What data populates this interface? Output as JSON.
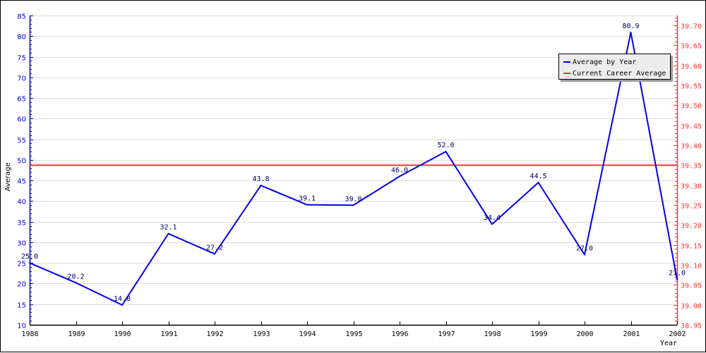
{
  "chart_data": {
    "type": "line",
    "title": "",
    "xlabel": "Year",
    "ylabel": "Average",
    "categories": [
      "1988",
      "1989",
      "1990",
      "1991",
      "1992",
      "1993",
      "1994",
      "1995",
      "1996",
      "1997",
      "1998",
      "1999",
      "2000",
      "2001",
      "2002"
    ],
    "series": [
      {
        "name": "Average by Year",
        "axis": "left",
        "color": "#0000ee",
        "values": [
          25.0,
          20.2,
          14.8,
          32.1,
          27.2,
          43.8,
          39.1,
          39.0,
          46.0,
          52.0,
          34.4,
          44.5,
          27.0,
          80.9,
          21.0
        ],
        "labels": [
          "25.0",
          "20.2",
          "14.8",
          "32.1",
          "27.2",
          "43.8",
          "39.1",
          "39.0",
          "46.0",
          "52.0",
          "34.4",
          "44.5",
          "27.0",
          "80.9",
          "21.0"
        ]
      },
      {
        "name": "Current Career Average",
        "axis": "right",
        "color": "#ff3333",
        "value": 39.35
      }
    ],
    "left_axis": {
      "color": "#0000cc",
      "ylim": [
        10,
        85
      ],
      "ticks": [
        "10",
        "15",
        "20",
        "25",
        "30",
        "35",
        "40",
        "45",
        "50",
        "55",
        "60",
        "65",
        "70",
        "75",
        "80",
        "85"
      ]
    },
    "right_axis": {
      "color": "#ff3333",
      "ylim": [
        38.95,
        39.725
      ],
      "ticks": [
        "38.95",
        "39.00",
        "39.05",
        "39.10",
        "39.15",
        "39.20",
        "39.25",
        "39.30",
        "39.35",
        "39.40",
        "39.45",
        "39.50",
        "39.55",
        "39.60",
        "39.65",
        "39.70"
      ]
    },
    "grid": true,
    "legend": "top-right"
  }
}
